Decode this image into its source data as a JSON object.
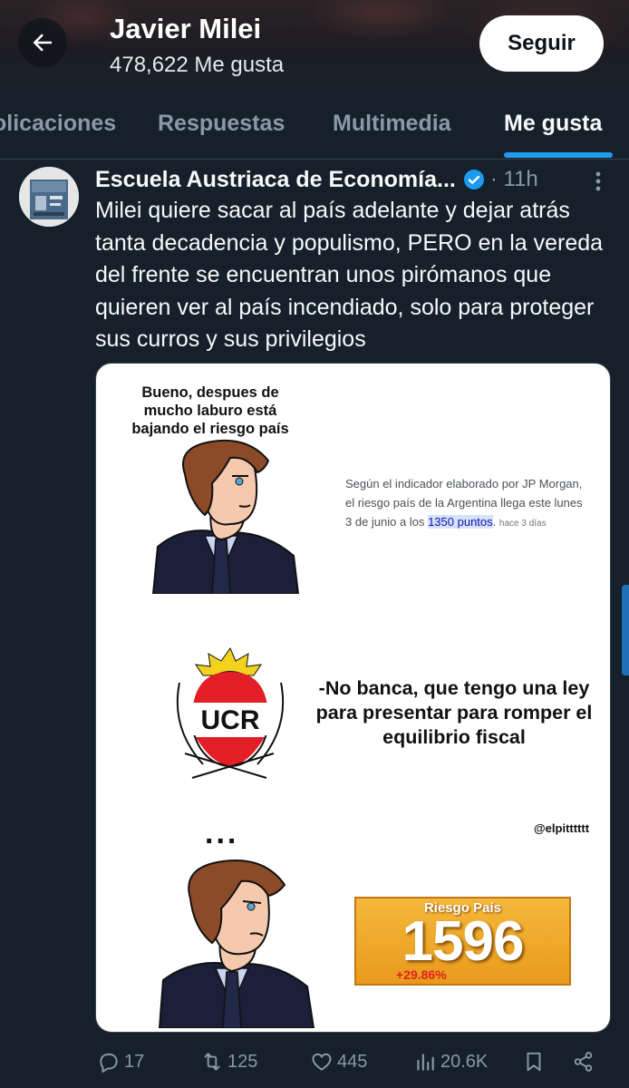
{
  "header": {
    "name": "Javier Milei",
    "likes_count": "478,622 Me gusta",
    "follow_label": "Seguir"
  },
  "tabs": [
    {
      "label": "olicaciones"
    },
    {
      "label": "Respuestas"
    },
    {
      "label": "Multimedia"
    },
    {
      "label": "Me gusta",
      "active": true
    }
  ],
  "tweet": {
    "author": "Escuela Austriaca de Economía...",
    "time": "· 11h",
    "text": "Milei quiere sacar al país adelante y dejar atrás tanta decadencia y populismo, PERO en la vereda del frente se encuentran unos pirómanos que quieren ver al país incendiado, solo para proteger sus curros y sus privilegios",
    "media": {
      "caption_top": "Bueno, despues de mucho laburo está bajando el riesgo país",
      "news_text": "Según el indicador elaborado por JP Morgan, el riesgo país de la Argentina llega este lunes 3 de junio a los",
      "news_highlight": "1350 puntos",
      "news_tail": ".",
      "news_ago": "hace 3 días",
      "ucr_label": "UCR",
      "caption_mid": "-No banca, que tengo una ley para presentar para romper el equilibrio fiscal",
      "ellipsis": "...",
      "watermark": "@elpitttttt",
      "riesgo_label": "Riesgo País",
      "riesgo_value": "1596",
      "riesgo_change": "+29.86%"
    },
    "stats": {
      "replies": "17",
      "retweets": "125",
      "likes": "445",
      "views": "20.6K"
    }
  },
  "colors": {
    "background": "#15202b",
    "accent": "#1d9bf0",
    "muted": "#8b98a5"
  }
}
